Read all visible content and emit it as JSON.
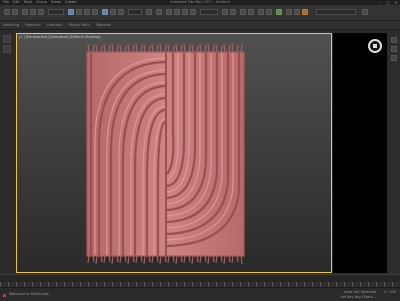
{
  "window": {
    "title": "Autodesk 3ds Max 2017 - Untitled",
    "menu": [
      "File",
      "Edit",
      "Tools",
      "Group",
      "Views",
      "Create"
    ],
    "controls": [
      "–",
      "□",
      "×"
    ]
  },
  "ribbon": {
    "tabs": [
      "Modeling",
      "Freeform",
      "Selection",
      "Object Paint",
      "Populate"
    ]
  },
  "viewport": {
    "label": "[+] [Perspective] [Standard] [Default Shading]",
    "active_border_color": "#f2c43d"
  },
  "rug": {
    "color": "#c97a7a",
    "shadow_color": "#9e5454",
    "highlight_color": "#e3a3a3",
    "fringe_color": "#b86262"
  },
  "nav": {
    "icon": "steering-wheel-icon"
  },
  "status": {
    "left": "Welcome to MAXScript.",
    "right_top": "Auto Key  Selected",
    "right_bottom": "Set Key  Key Filters...",
    "frame": "0 / 100"
  }
}
